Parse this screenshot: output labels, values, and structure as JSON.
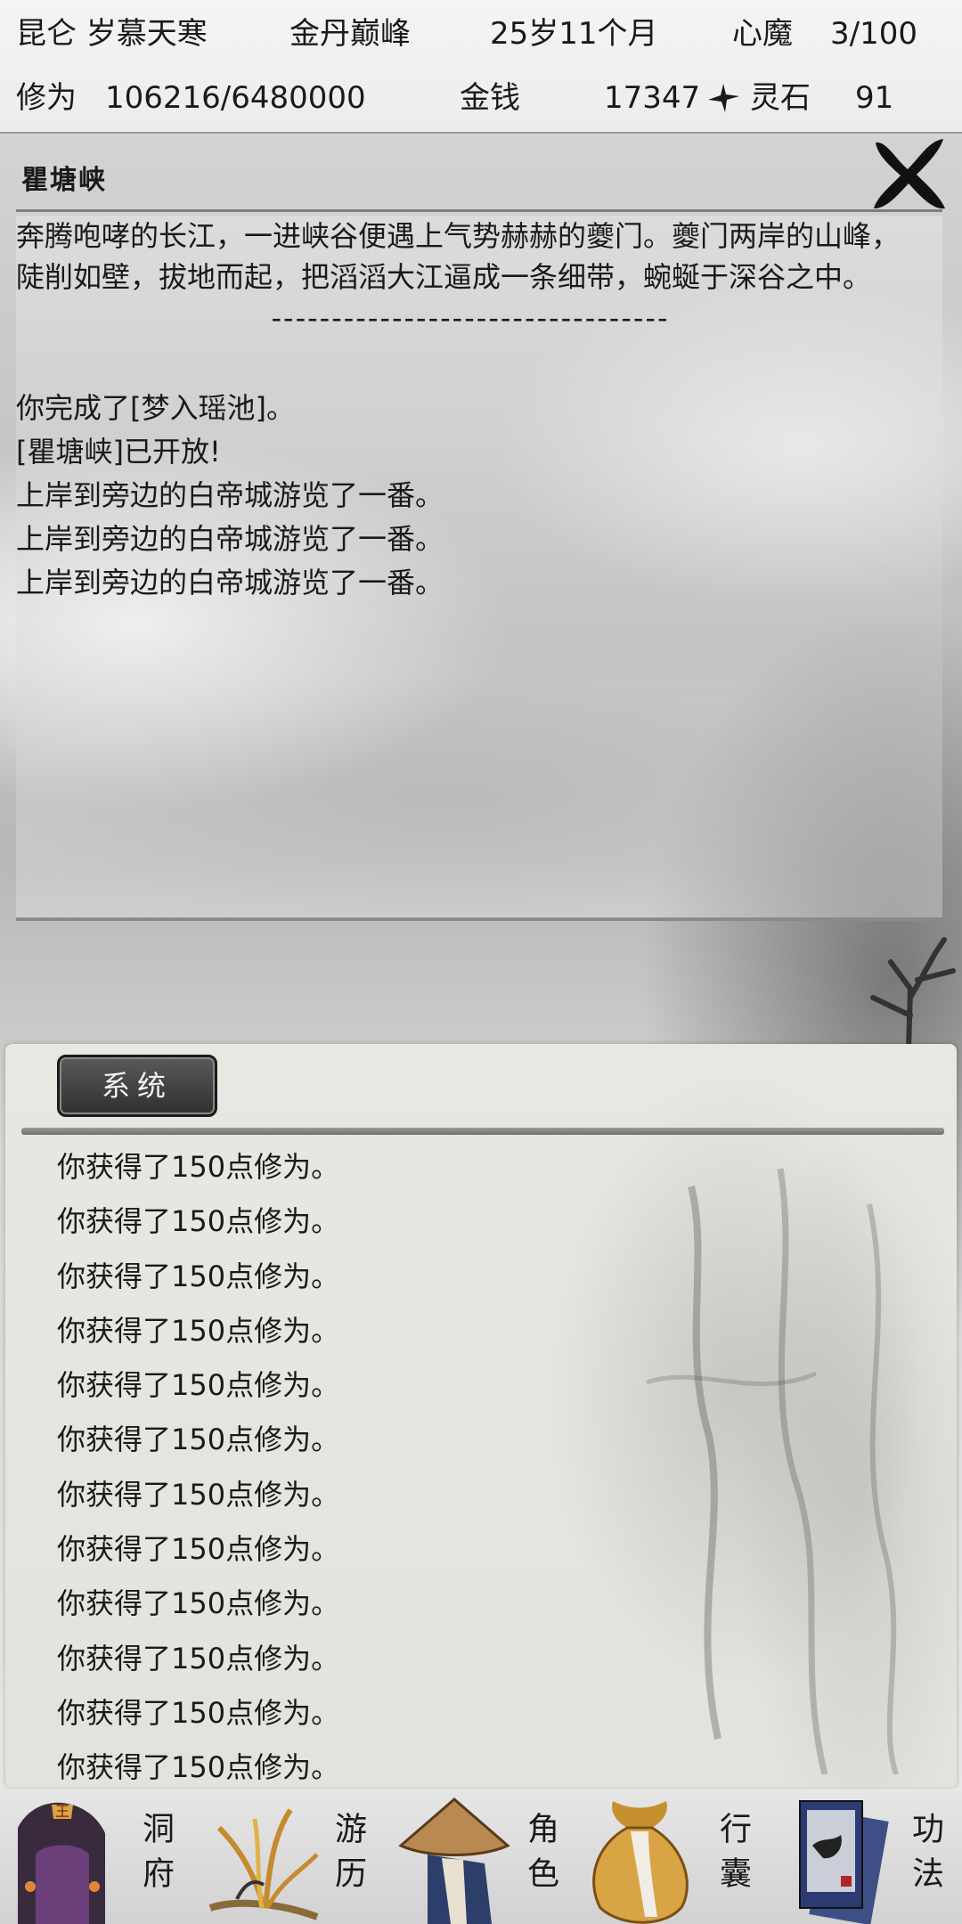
{
  "status": {
    "location": "昆仑 岁慕天寒",
    "realm": "金丹巅峰",
    "age": "25岁11个月",
    "heart_demon_label": "心魔",
    "heart_demon_value": "3/100",
    "cultivation_label": "修为",
    "cultivation_value": "106216/6480000",
    "money_label": "金钱",
    "money_value": "17347",
    "spirit_stone_label": "灵石",
    "spirit_stone_value": "91"
  },
  "location_panel": {
    "title": "瞿塘峡",
    "close_icon": "close-x-icon",
    "description": "奔腾咆哮的长江，一进峡谷便遇上气势赫赫的夔门。夔门两岸的山峰，陡削如壁，拔地而起，把滔滔大江逼成一条细带，蜿蜒于深谷之中。",
    "separator": "---------------------------------",
    "events": [
      "你完成了[梦入瑶池]。",
      "[瞿塘峡]已开放!",
      "上岸到旁边的白帝城游览了一番。",
      "上岸到旁边的白帝城游览了一番。",
      "上岸到旁边的白帝城游览了一番。"
    ]
  },
  "system_panel": {
    "tab_label": "系统",
    "messages": [
      "你获得了150点修为。",
      "你获得了150点修为。",
      "你获得了150点修为。",
      "你获得了150点修为。",
      "你获得了150点修为。",
      "你获得了150点修为。",
      "你获得了150点修为。",
      "你获得了150点修为。",
      "你获得了150点修为。",
      "你获得了150点修为。",
      "你获得了150点修为。",
      "你获得了150点修为。"
    ]
  },
  "nav": {
    "items": [
      {
        "label": "洞府",
        "icon": "cave-dwelling-icon"
      },
      {
        "label": "游历",
        "icon": "travel-grass-icon"
      },
      {
        "label": "角色",
        "icon": "character-hat-icon"
      },
      {
        "label": "行囊",
        "icon": "bag-icon"
      },
      {
        "label": "功法",
        "icon": "scroll-books-icon"
      }
    ]
  },
  "colors": {
    "tab_bg": "#3c3c3c",
    "panel_bg": "#e7e5df",
    "text": "#1a1a1a"
  }
}
